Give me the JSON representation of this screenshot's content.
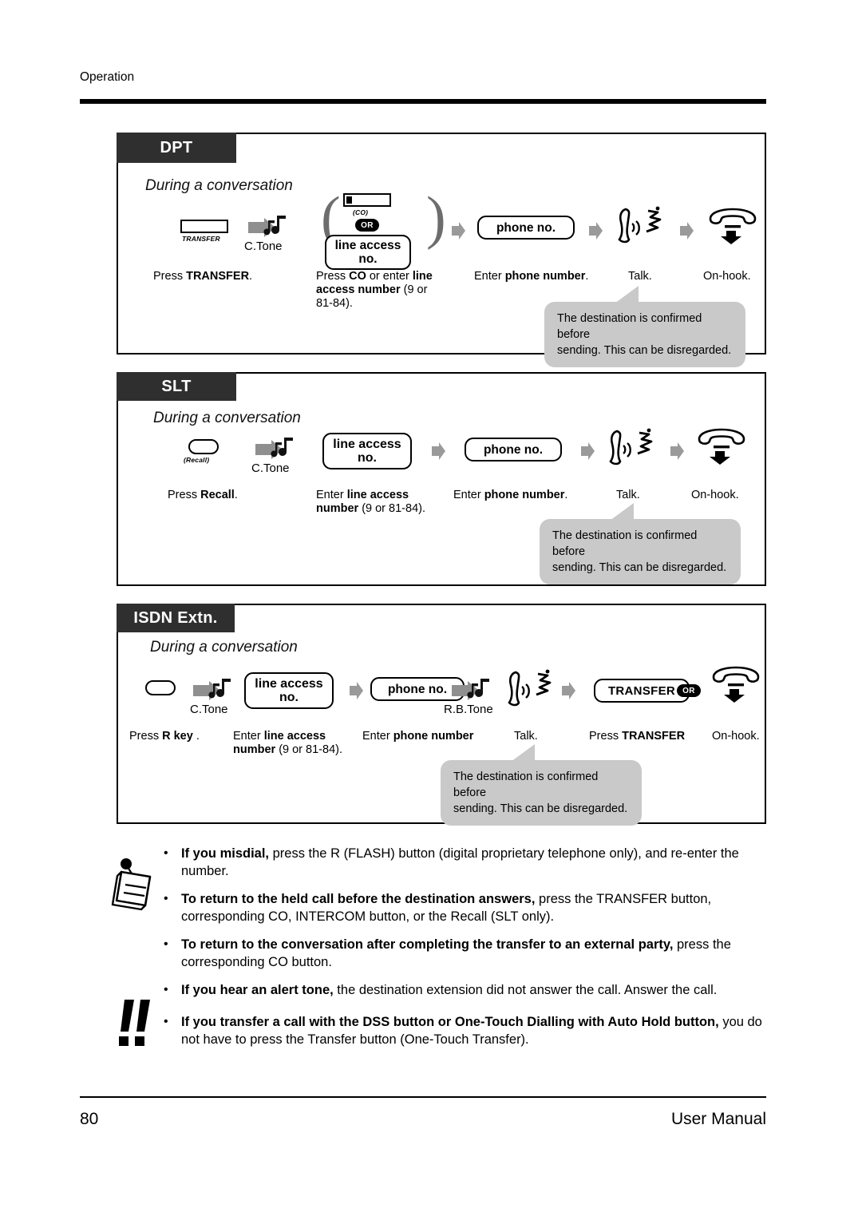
{
  "header": {
    "section_label": "Operation"
  },
  "footer": {
    "page_number": "80",
    "manual_label": "User Manual"
  },
  "note_balloon": {
    "line1": "The destination is confirmed before",
    "line2": "sending. This can be disregarded."
  },
  "panels": [
    {
      "tag": "DPT",
      "subtitle": "During a conversation",
      "steps": [
        {
          "icon": "transfer-key-icon",
          "key_label": "TRANSFER",
          "caption_pre": "Press ",
          "caption_bold": "TRANSFER",
          "caption_post": "."
        },
        {
          "icon": "confirmation-tone-icon",
          "tone_label": "C.Tone"
        },
        {
          "icon": "co-key-icon",
          "key_label": "(CO)",
          "or_label": "OR",
          "capsule_line1": "line access",
          "capsule_line2": "no.",
          "caption_pre": "Press ",
          "caption_bold": "CO",
          "caption_mid": " or enter",
          "caption_bold2": "line access number",
          "caption_post": "(9 or 81-84)."
        },
        {
          "icon": "phone-no-capsule",
          "capsule_line1": "phone no.",
          "caption_pre": "Enter ",
          "caption_bold": "phone number",
          "caption_post": "."
        },
        {
          "icon": "talk-icon",
          "caption": "Talk."
        },
        {
          "icon": "on-hook-icon",
          "caption": "On-hook."
        }
      ]
    },
    {
      "tag": "SLT",
      "subtitle": "During a conversation",
      "steps": [
        {
          "icon": "recall-key-icon",
          "key_label": "(Recall)",
          "caption_pre": "Press ",
          "caption_bold": "Recall",
          "caption_post": "."
        },
        {
          "icon": "confirmation-tone-icon",
          "tone_label": "C.Tone"
        },
        {
          "icon": "line-access-capsule",
          "capsule_line1": "line access",
          "capsule_line2": "no.",
          "caption_pre": "Enter ",
          "caption_bold": "line access",
          "caption_bold2": "number",
          "caption_post": " (9 or 81-84)."
        },
        {
          "icon": "phone-no-capsule",
          "capsule_line1": "phone no.",
          "caption_pre": "Enter ",
          "caption_bold": "phone number",
          "caption_post": "."
        },
        {
          "icon": "talk-icon",
          "caption": "Talk."
        },
        {
          "icon": "on-hook-icon",
          "caption": "On-hook."
        }
      ]
    },
    {
      "tag": "ISDN Extn.",
      "subtitle": "During a conversation",
      "steps": [
        {
          "icon": "r-key-icon",
          "caption_pre": "Press ",
          "caption_bold": "R key",
          "caption_post": " ."
        },
        {
          "icon": "confirmation-tone-icon",
          "tone_label": "C.Tone"
        },
        {
          "icon": "line-access-capsule",
          "capsule_line1": "line access",
          "capsule_line2": "no.",
          "caption_pre": "Enter ",
          "caption_bold": "line access",
          "caption_bold2": "number",
          "caption_post": " (9 or 81-84)."
        },
        {
          "icon": "phone-no-capsule",
          "capsule_line1": "phone no.",
          "caption_pre": "Enter ",
          "caption_bold": "phone number"
        },
        {
          "icon": "ringback-tone-icon",
          "tone_label": "R.B.Tone"
        },
        {
          "icon": "talk-icon",
          "caption": "Talk."
        },
        {
          "icon": "transfer-capsule",
          "capsule_line1": "TRANSFER",
          "or_label": "OR",
          "caption_pre": "Press ",
          "caption_bold": "TRANSFER"
        },
        {
          "icon": "on-hook-icon",
          "caption": "On-hook."
        }
      ]
    }
  ],
  "notes": {
    "bullet_char": "•",
    "items": [
      {
        "bold": "If you misdial,",
        "rest": " press the R (FLASH) button (digital proprietary telephone only), and re-enter the number."
      },
      {
        "bold": "To return to the held call before the destination answers,",
        "rest": " press the TRANSFER button, corresponding CO, INTERCOM button, or the Recall (SLT only)."
      },
      {
        "bold": "To return to the conversation after completing the transfer to an external party,",
        "rest": " press the corresponding CO button."
      },
      {
        "bold": "If you hear an alert tone,",
        "rest": " the destination extension did not answer the call. Answer the call."
      },
      {
        "bold": "If you transfer a call with the DSS button or One-Touch Dialling with Auto Hold button,",
        "rest": " you do not have to press the Transfer button (One-Touch Transfer)."
      }
    ]
  },
  "colors": {
    "tag_bg": "#2f2f2f",
    "arrow_grey": "#9a9a9a",
    "balloon_grey": "#c9c9c9"
  }
}
